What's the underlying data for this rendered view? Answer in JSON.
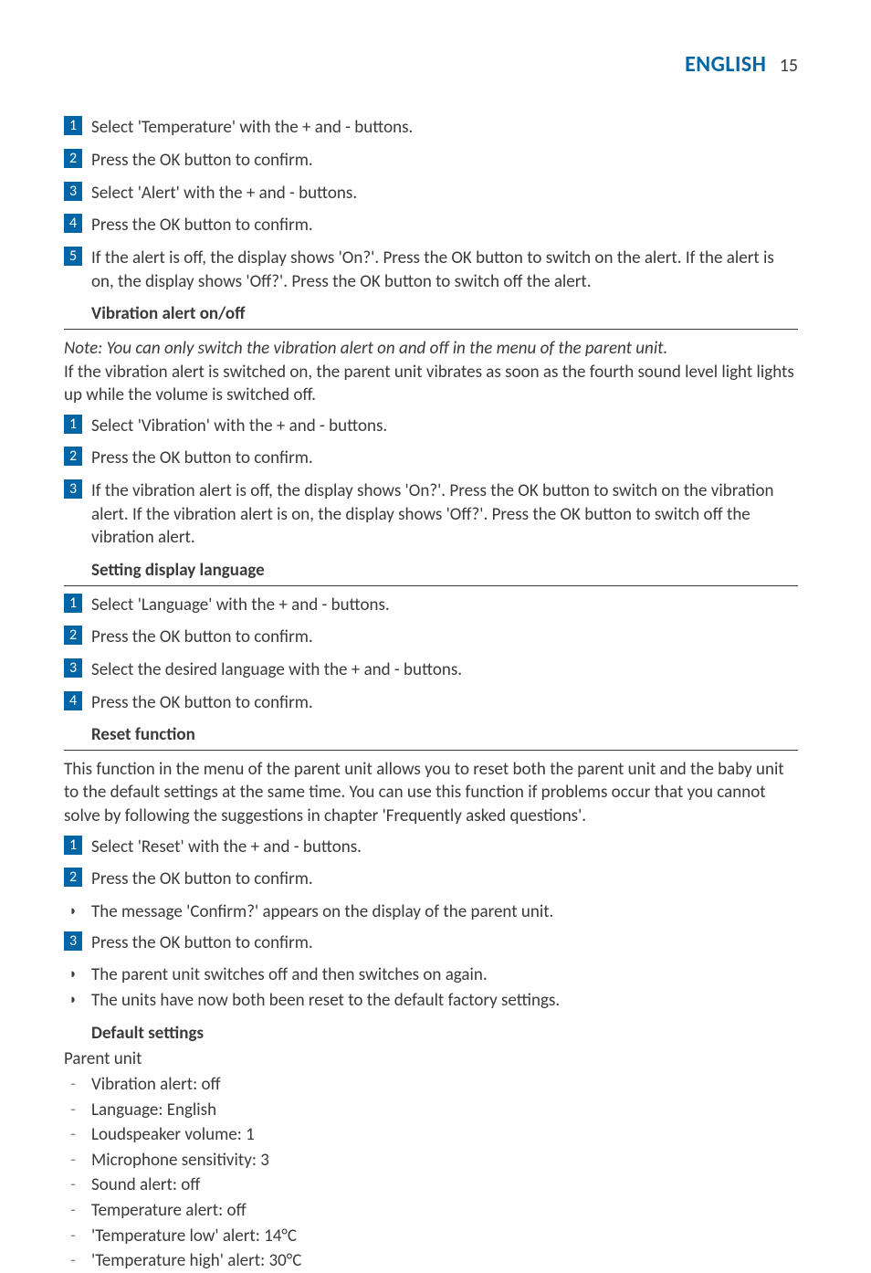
{
  "header": {
    "language": "ENGLISH",
    "page": "15"
  },
  "section_temp": {
    "steps": [
      "Select 'Temperature' with the + and - buttons.",
      "Press the OK button to confirm.",
      "Select 'Alert' with the + and - buttons.",
      "Press the OK button to confirm.",
      "If the alert is off, the display shows 'On?'. Press the OK button to switch on the alert. If the alert is on, the display shows 'Off?'. Press the OK button to switch off the alert."
    ]
  },
  "section_vibration": {
    "heading": "Vibration alert on/off",
    "note": "Note: You can only switch the vibration alert on and off in the menu of the parent unit.",
    "intro": "If the vibration alert is switched on, the parent unit vibrates as soon as the fourth sound level light lights up while the volume is switched off.",
    "steps": [
      "Select 'Vibration' with the + and - buttons.",
      "Press the OK button to confirm.",
      "If the vibration alert is off, the display shows 'On?'. Press the OK button to switch on the vibration alert. If the vibration alert is on, the display shows 'Off?'. Press the OK button to switch off the vibration alert."
    ]
  },
  "section_language": {
    "heading": "Setting display language",
    "steps": [
      "Select 'Language' with the + and - buttons.",
      "Press the OK button to confirm.",
      "Select the desired language with the + and - buttons.",
      "Press the OK button to confirm."
    ]
  },
  "section_reset": {
    "heading": "Reset function",
    "intro": "This function in the menu of the parent unit allows you to reset both the parent unit and the baby unit to the default settings at the same time. You can use this function if problems occur that you cannot solve by following the suggestions in chapter 'Frequently asked questions'.",
    "steps": [
      {
        "num": "1",
        "text": "Select 'Reset' with the + and - buttons.",
        "bullets": []
      },
      {
        "num": "2",
        "text": "Press the OK button to confirm.",
        "bullets": [
          "The message 'Confirm?' appears on the display of the parent unit."
        ]
      },
      {
        "num": "3",
        "text": "Press the OK button to confirm.",
        "bullets": [
          "The parent unit switches off and then switches on again.",
          "The units have now both been reset to the default factory settings."
        ]
      }
    ]
  },
  "section_defaults": {
    "heading": "Default settings",
    "sub": "Parent unit",
    "items": [
      "Vibration alert: off",
      "Language: English",
      "Loudspeaker volume: 1",
      "Microphone sensitivity: 3",
      "Sound alert: off",
      "Temperature alert: off",
      "'Temperature low' alert: 14°C",
      "'Temperature high' alert: 30°C"
    ]
  }
}
